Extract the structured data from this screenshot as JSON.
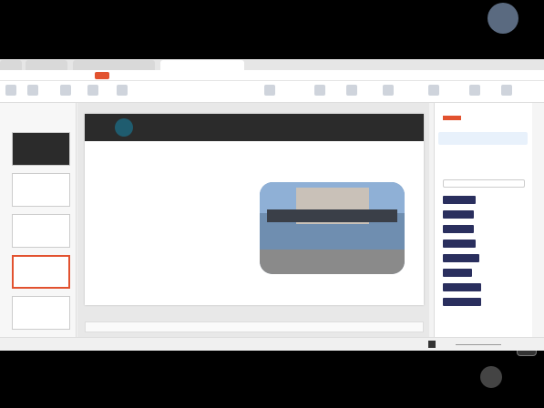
{
  "window": {
    "tab_active": "",
    "tab_2": "",
    "tab_3": "",
    "tab_home": ""
  },
  "slide": {
    "number": "",
    "title": "",
    "body": ""
  },
  "overlay": {
    "presenter_label": ""
  },
  "status": {
    "page_indicator": "",
    "zoom": ""
  },
  "colors": {
    "accent": "#e2522f",
    "title_bar": "#2b2b2b",
    "badge": "#1f5c6f",
    "font_sample": "#2a2f5e"
  }
}
